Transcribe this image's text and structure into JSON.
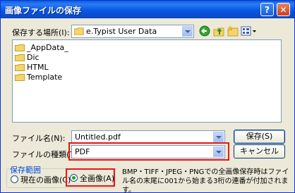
{
  "window": {
    "title": "画像ファイルの保存",
    "help_glyph": "?",
    "close_glyph": "✕"
  },
  "save_in": {
    "label": "保存する場所(I):",
    "value": "e.Typist User Data",
    "icons": [
      "folder-icon",
      "back-icon",
      "up-folder-icon",
      "new-folder-icon",
      "view-menu-icon"
    ]
  },
  "file_list": {
    "items": [
      {
        "name": "_AppData_",
        "icon": "folder-icon"
      },
      {
        "name": "Dic",
        "icon": "folder-icon"
      },
      {
        "name": "HTML",
        "icon": "folder-icon"
      },
      {
        "name": "Template",
        "icon": "folder-icon"
      }
    ]
  },
  "file_name": {
    "label": "ファイル名(N):",
    "value": "Untitled.pdf"
  },
  "file_type": {
    "label": "ファイルの種類(T):",
    "value": "PDF"
  },
  "buttons": {
    "save": "保存(S)",
    "cancel": "キャンセル"
  },
  "save_range": {
    "title": "保存範囲",
    "options": [
      {
        "label": "現在の画像(C)",
        "checked": false
      },
      {
        "label": "全画像(A)",
        "checked": true
      }
    ]
  },
  "note": "BMP・TIFF・JPEG・PNGでの全画像保存時はファイル名の末尾に001から始まる3桁の連番が付加されます。",
  "colors": {
    "highlight": "#e8161b",
    "title_bar": "#0a5fdd",
    "dialog_bg": "#ece9d8"
  }
}
